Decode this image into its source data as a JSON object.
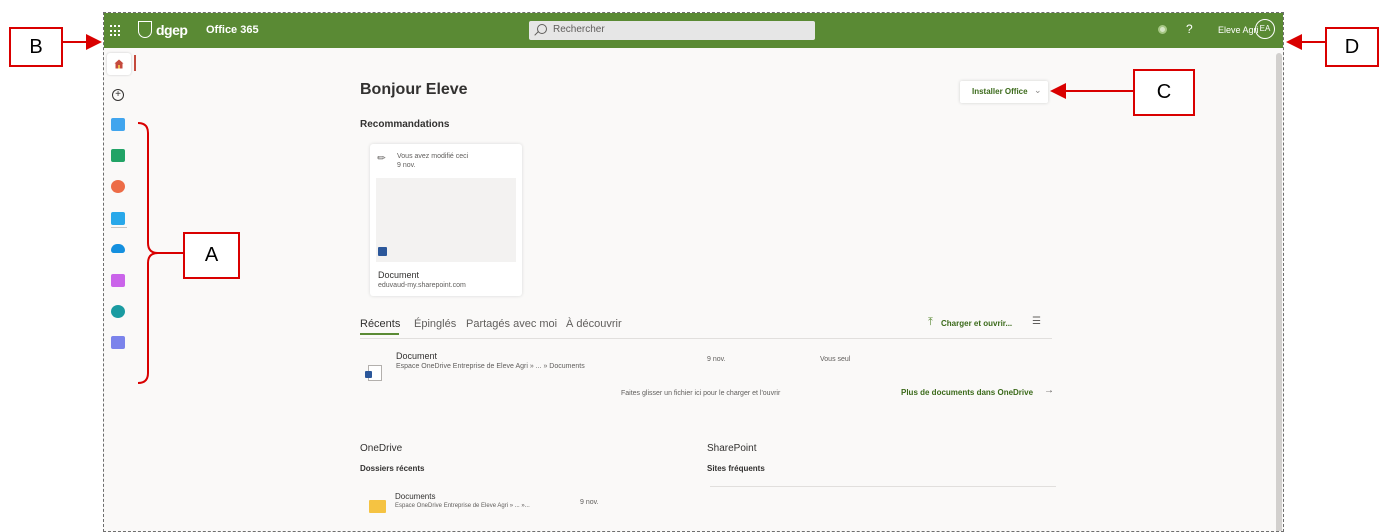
{
  "header": {
    "brand": "dgep",
    "app_title": "Office 365",
    "search_placeholder": "Rechercher",
    "help_glyph": "?",
    "user_name": "Eleve Agri",
    "user_initials": "EA"
  },
  "rail": {
    "icons": [
      "home-icon",
      "create-icon",
      "word-icon",
      "excel-icon",
      "powerpoint-icon",
      "outlook-icon",
      "onedrive-icon",
      "onenote-icon",
      "sharepoint-icon",
      "teams-icon"
    ]
  },
  "main": {
    "greeting": "Bonjour Eleve",
    "install_label": "Installer Office",
    "recommendations_title": "Recommandations",
    "rec_card": {
      "activity": "Vous avez modifié ceci",
      "date": "9 nov.",
      "name": "Document",
      "location": "eduvaud-my.sharepoint.com"
    },
    "tabs": [
      "Récents",
      "Épinglés",
      "Partagés avec moi",
      "À découvrir"
    ],
    "upload_label": "Charger et ouvrir...",
    "recent_row": {
      "name": "Document",
      "path": "Espace OneDrive Entreprise de Eleve Agri » ... » Documents",
      "date": "9 nov.",
      "sharing": "Vous seul"
    },
    "drop_hint": "Faites glisser un fichier ici pour le charger et l'ouvrir",
    "more_docs": "Plus de documents dans OneDrive",
    "onedrive_title": "OneDrive",
    "recent_folders_title": "Dossiers récents",
    "folder": {
      "name": "Documents",
      "path": "Espace OneDrive Entreprise de Eleve Agri » ... »...",
      "date": "9 nov."
    },
    "sharepoint_title": "SharePoint",
    "frequent_sites_title": "Sites fréquents"
  },
  "annotations": {
    "a": "A",
    "b": "B",
    "c": "C",
    "d": "D"
  },
  "colors": {
    "header": "#5a8a34",
    "annotation": "#d90000"
  }
}
